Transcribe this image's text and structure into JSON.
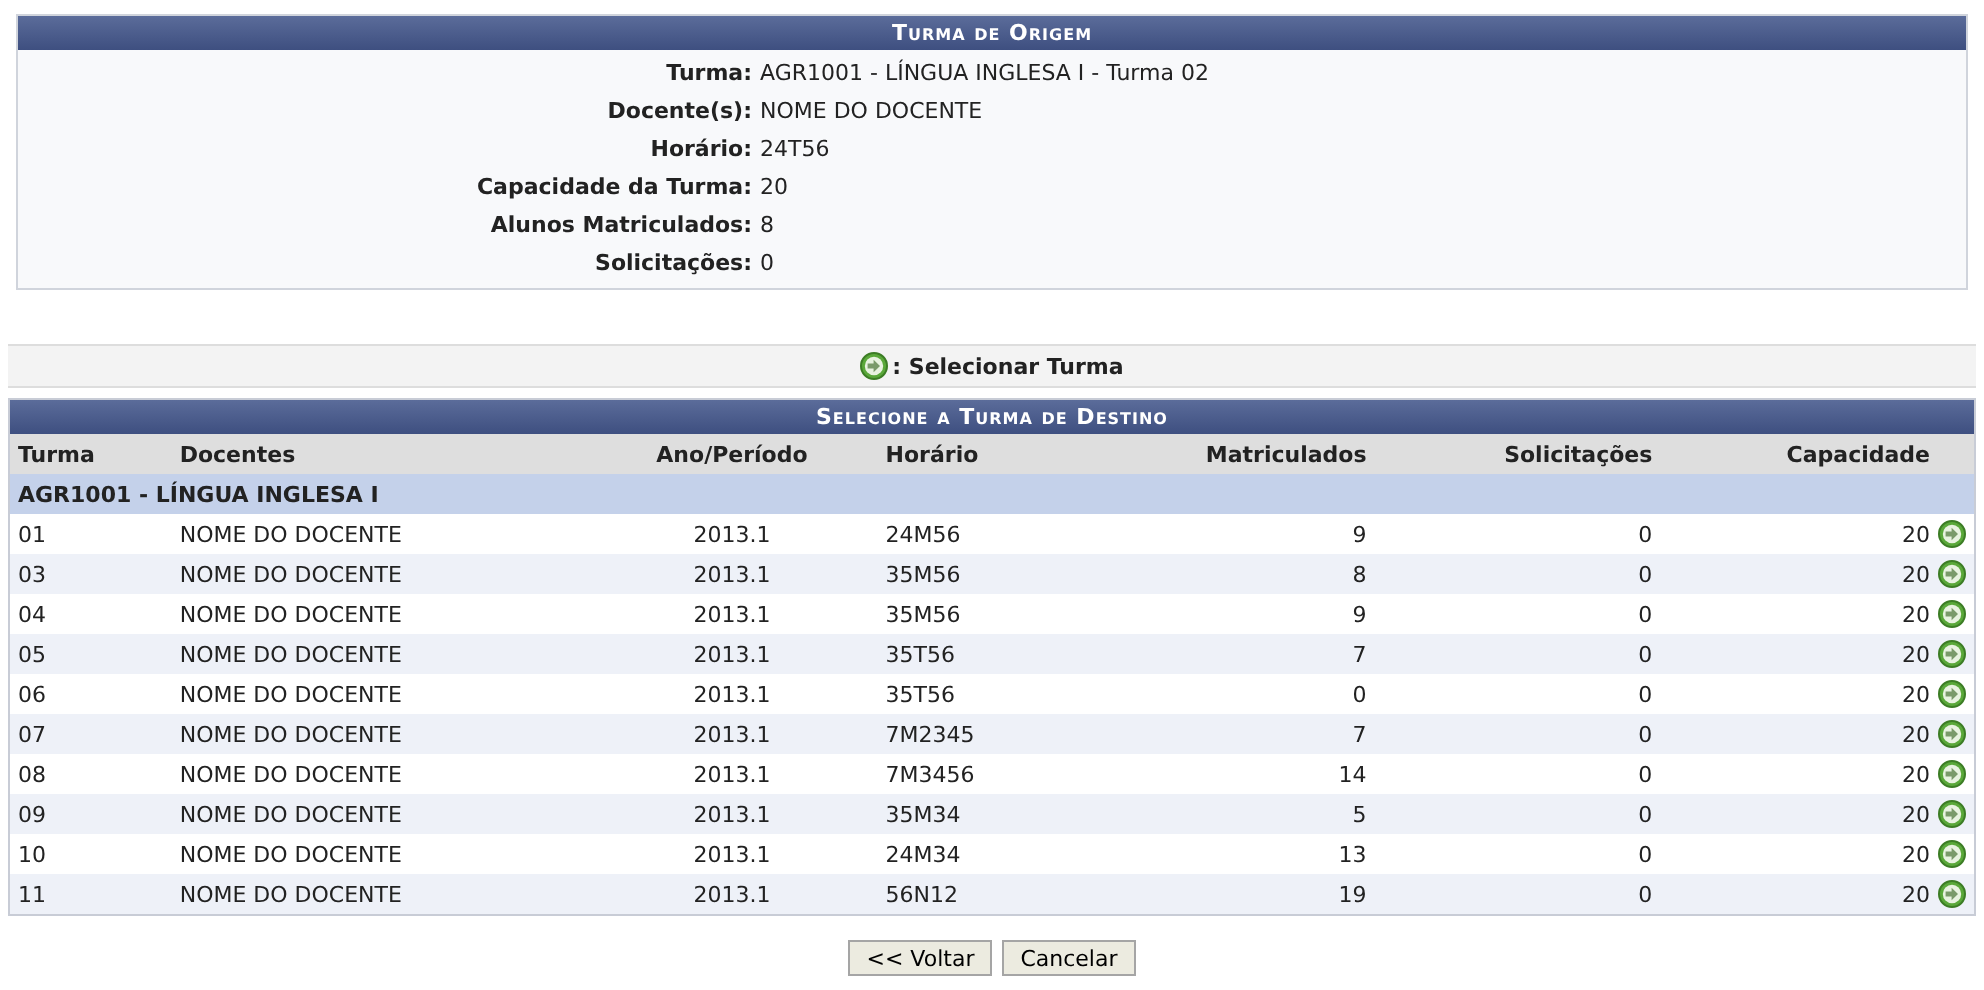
{
  "origin": {
    "title": "Turma de Origem",
    "fields": [
      {
        "label": "Turma:",
        "value": "AGR1001 - LÍNGUA INGLESA I - Turma 02"
      },
      {
        "label": "Docente(s):",
        "value": "NOME DO DOCENTE"
      },
      {
        "label": "Horário:",
        "value": "24T56"
      },
      {
        "label": "Capacidade da Turma:",
        "value": "20"
      },
      {
        "label": "Alunos Matriculados:",
        "value": "8"
      },
      {
        "label": "Solicitações:",
        "value": "0"
      }
    ]
  },
  "legend": ": Selecionar Turma",
  "table": {
    "title": "Selecione a Turma de Destino",
    "columns": [
      "Turma",
      "Docentes",
      "Ano/Período",
      "Horário",
      "Matriculados",
      "Solicitações",
      "Capacidade"
    ],
    "group": "AGR1001 - LÍNGUA INGLESA I",
    "rows": [
      [
        "01",
        "NOME DO DOCENTE",
        "2013.1",
        "24M56",
        "9",
        "0",
        "20"
      ],
      [
        "03",
        "NOME DO DOCENTE",
        "2013.1",
        "35M56",
        "8",
        "0",
        "20"
      ],
      [
        "04",
        "NOME DO DOCENTE",
        "2013.1",
        "35M56",
        "9",
        "0",
        "20"
      ],
      [
        "05",
        "NOME DO DOCENTE",
        "2013.1",
        "35T56",
        "7",
        "0",
        "20"
      ],
      [
        "06",
        "NOME DO DOCENTE",
        "2013.1",
        "35T56",
        "0",
        "0",
        "20"
      ],
      [
        "07",
        "NOME DO DOCENTE",
        "2013.1",
        "7M2345",
        "7",
        "0",
        "20"
      ],
      [
        "08",
        "NOME DO DOCENTE",
        "2013.1",
        "7M3456",
        "14",
        "0",
        "20"
      ],
      [
        "09",
        "NOME DO DOCENTE",
        "2013.1",
        "35M34",
        "5",
        "0",
        "20"
      ],
      [
        "10",
        "NOME DO DOCENTE",
        "2013.1",
        "24M34",
        "13",
        "0",
        "20"
      ],
      [
        "11",
        "NOME DO DOCENTE",
        "2013.1",
        "56N12",
        "19",
        "0",
        "20"
      ]
    ]
  },
  "buttons": [
    "<< Voltar",
    "Cancelar"
  ]
}
